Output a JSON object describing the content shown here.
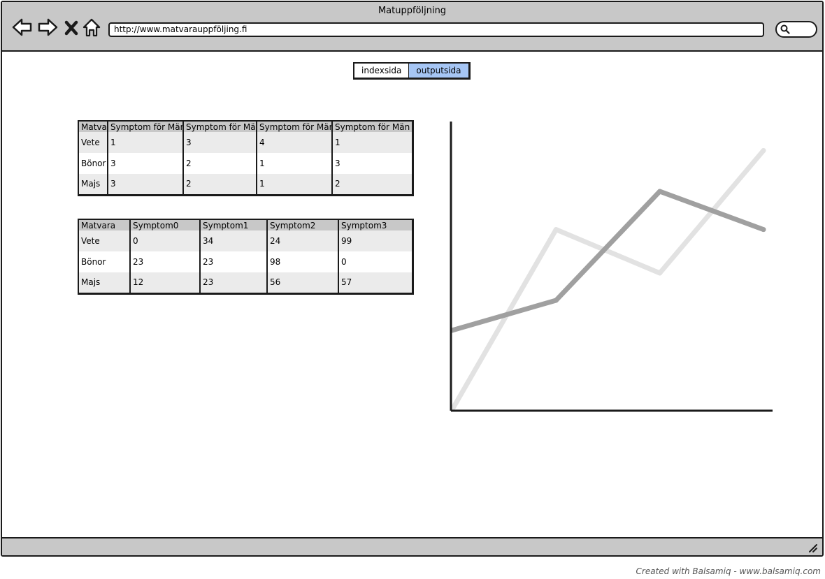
{
  "window": {
    "title": "Matuppföljning",
    "url": "http://www.matvarauppföljing.fi"
  },
  "toolbar": {
    "icons": [
      "back-arrow-icon",
      "forward-arrow-icon",
      "close-x-icon",
      "home-icon",
      "search-icon"
    ]
  },
  "tabs": [
    {
      "label": "indexsida",
      "active": false
    },
    {
      "label": "outputsida",
      "active": true
    }
  ],
  "colors": {
    "active_tab": "#a6c6f5",
    "chrome": "#c8c8c8",
    "series_dark": "#a0a0a0",
    "series_light": "#e2e2e2"
  },
  "table1": {
    "headers": [
      "Matvara",
      "Symptom för Män",
      "Symptom för Män",
      "Symptom för Män",
      "Symptom för Män"
    ],
    "rows": [
      [
        "Vete",
        "1",
        "3",
        "4",
        "1"
      ],
      [
        "Bönor",
        "3",
        "2",
        "1",
        "3"
      ],
      [
        "Majs",
        "3",
        "2",
        "1",
        "2"
      ]
    ]
  },
  "table2": {
    "headers": [
      "Matvara",
      "Symptom0",
      "Symptom1",
      "Symptom2",
      "Symptom3"
    ],
    "rows": [
      [
        "Vete",
        "0",
        "34",
        "24",
        "99"
      ],
      [
        "Bönor",
        "23",
        "23",
        "98",
        "0"
      ],
      [
        "Majs",
        "12",
        "23",
        "56",
        "57"
      ]
    ]
  },
  "chart_data": {
    "type": "line",
    "x": [
      0,
      1,
      2,
      3
    ],
    "ylim": [
      0,
      100
    ],
    "grid": false,
    "series": [
      {
        "values": [
          29,
          40,
          80,
          66
        ],
        "color": "#a0a0a0"
      },
      {
        "values": [
          0,
          66,
          50,
          95
        ],
        "color": "#e2e2e2"
      }
    ]
  },
  "footer": {
    "credit": "Created with Balsamiq - www.balsamiq.com"
  }
}
